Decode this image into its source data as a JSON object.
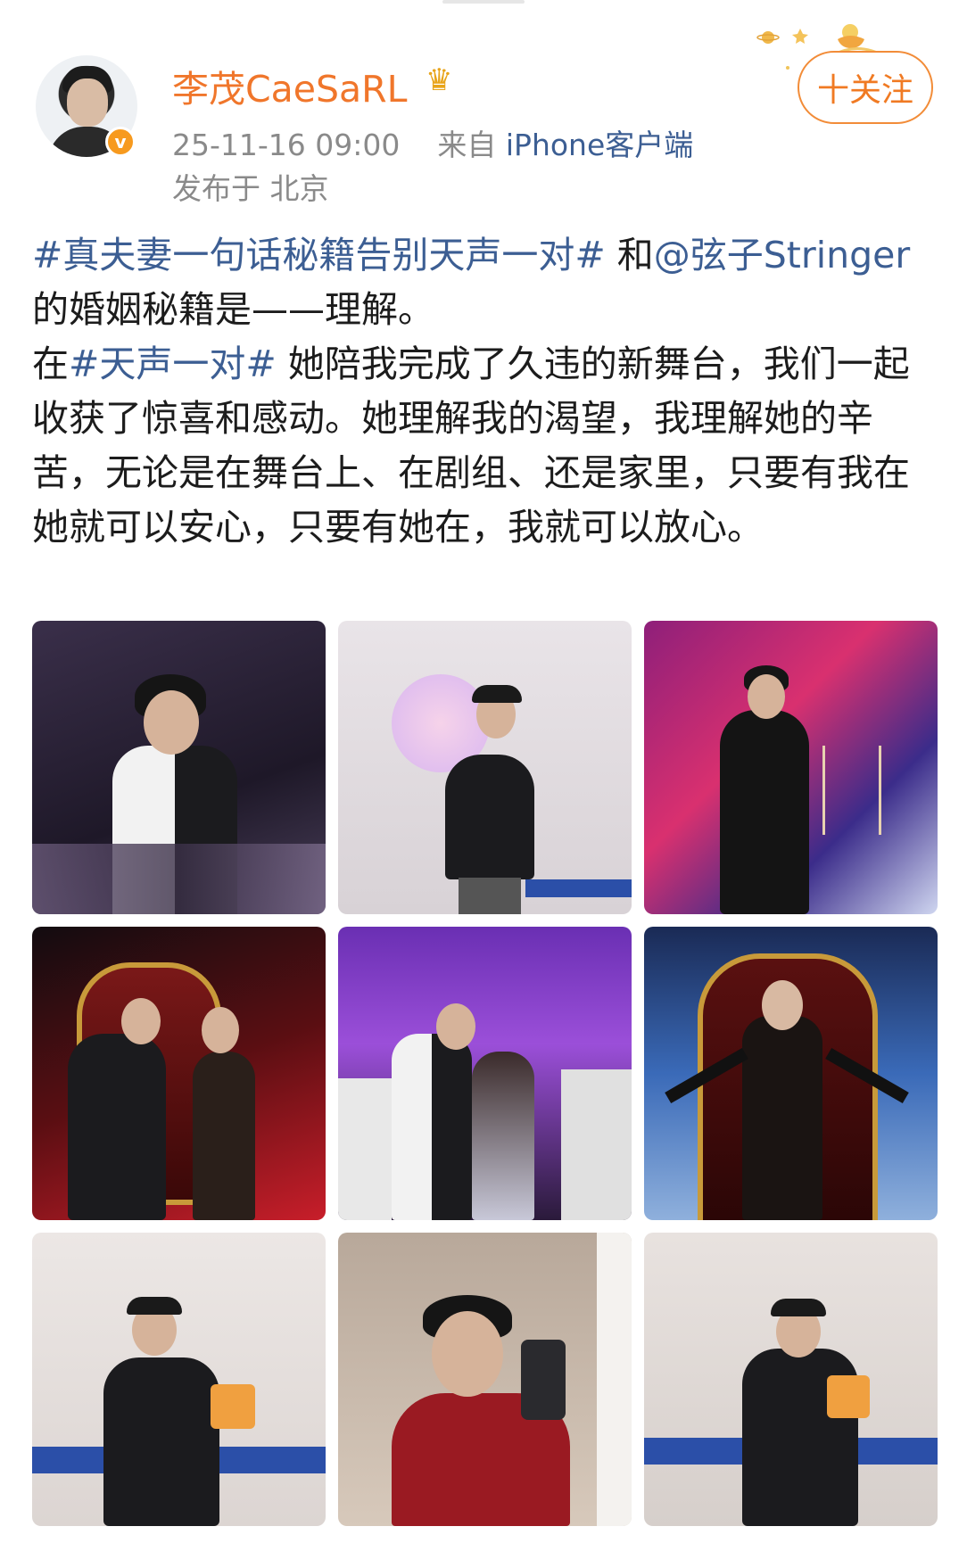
{
  "author": {
    "name": "李茂CaeSaRL",
    "verified_badge": "v",
    "crown_icon": "crown-icon"
  },
  "post_meta": {
    "timestamp": "25-11-16 09:00",
    "source_prefix": "来自",
    "source": "iPhone客户端",
    "location": "发布于 北京"
  },
  "follow_button": {
    "label": "十关注"
  },
  "post": {
    "hashtag1": "#真夫妻一句话秘籍告别天声一对#",
    "text1": " 和",
    "mention": "@弦子Stringer",
    "text2": " 的婚姻秘籍是——理解。",
    "text3": "在",
    "hashtag2": "#天声一对#",
    "text4": " 她陪我完成了久违的新舞台，我们一起收获了惊喜和感动。她理解我的渴望，我理解她的辛苦，无论是在舞台上、在剧组、还是家里，只要有我在她就可以安心，只要有她在，我就可以放心。"
  },
  "images": [
    {
      "name": "stage-performance-white-jacket"
    },
    {
      "name": "rehearsal-room-black-cap"
    },
    {
      "name": "stage-black-suit-candelabra"
    },
    {
      "name": "duet-throne-red-stage"
    },
    {
      "name": "duet-purple-stage-dancers"
    },
    {
      "name": "female-singer-throne-blue"
    },
    {
      "name": "rehearsal-sitting-cap"
    },
    {
      "name": "mirror-selfie-red-sweater"
    },
    {
      "name": "rehearsal-sitting-side"
    }
  ],
  "colors": {
    "username": "#f0762b",
    "link": "#3c5e93",
    "meta_gray": "#8a8a8a",
    "follow_orange": "#f07a23"
  }
}
